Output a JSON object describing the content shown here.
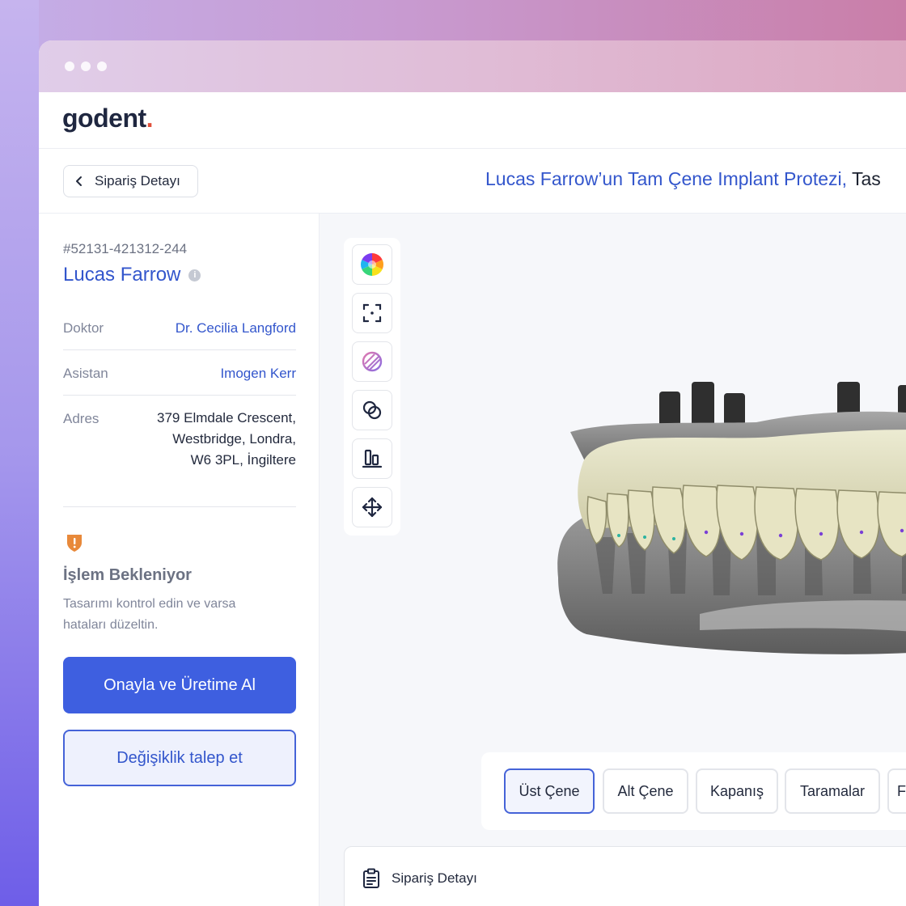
{
  "app": {
    "logo_text": "godent",
    "logo_dot": ".",
    "brand_color": "#3e5fe0",
    "logo_dot_color": "#e0503b"
  },
  "header": {
    "back_label": "Sipariş Detayı",
    "title_primary": "Lucas Farrow’un Tam Çene Implant Protezi,",
    "title_secondary": "Tas"
  },
  "order": {
    "id": "#52131-421312-244",
    "patient": "Lucas Farrow",
    "fields": [
      {
        "label": "Doktor",
        "value": "Dr. Cecilia Langford"
      },
      {
        "label": "Asistan",
        "value": "Imogen Kerr"
      },
      {
        "label": "Adres",
        "lines": [
          "379 Elmdale Crescent,",
          "Westbridge, Londra,",
          "W6 3PL, İngiltere"
        ]
      }
    ]
  },
  "status": {
    "title": "İşlem Bekleniyor",
    "description": "Tasarımı kontrol edin ve varsa hataları düzeltin.",
    "icon": "shield-warning-icon",
    "color": "#e8893a"
  },
  "actions": {
    "approve_label": "Onayla ve Üretime Al",
    "request_change_label": "Değişiklik talep et"
  },
  "viewer": {
    "tools": [
      "color-wheel-icon",
      "focus-frame-icon",
      "texture-icon",
      "overlap-icon",
      "align-bottom-icon",
      "move-arrows-icon"
    ],
    "tabs": [
      {
        "label": "Üst Çene",
        "active": true
      },
      {
        "label": "Alt Çene",
        "active": false
      },
      {
        "label": "Kapanış",
        "active": false
      },
      {
        "label": "Taramalar",
        "active": false
      },
      {
        "label": "F",
        "active": false
      }
    ]
  },
  "detail": {
    "title": "Sipariş Detayı",
    "icon": "clipboard-icon"
  }
}
